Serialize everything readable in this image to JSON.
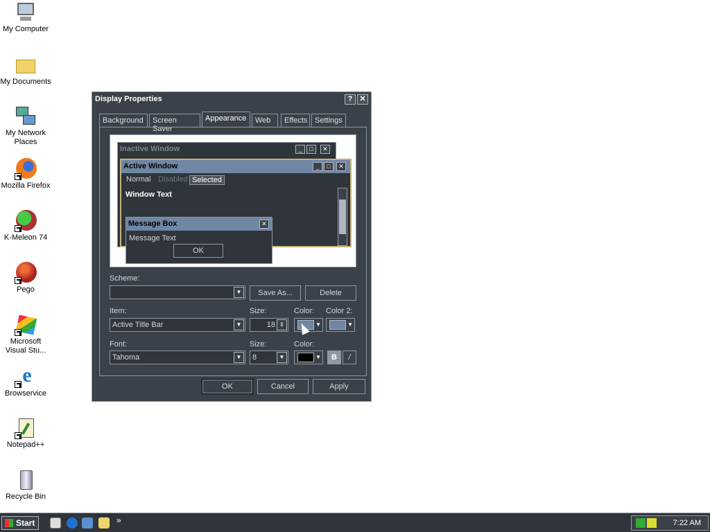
{
  "desktop": {
    "icons": [
      {
        "label": "My Computer"
      },
      {
        "label": "My Documents"
      },
      {
        "label": "My Network Places"
      },
      {
        "label": "Mozilla Firefox"
      },
      {
        "label": "K-Meleon 74"
      },
      {
        "label": "Pego"
      },
      {
        "label": "Microsoft Visual Stu..."
      },
      {
        "label": "Browservice"
      },
      {
        "label": "Notepad++"
      },
      {
        "label": "Recycle Bin"
      }
    ]
  },
  "dialog": {
    "title": "Display Properties",
    "help": "?",
    "close": "✕",
    "tabs": [
      "Background",
      "Screen Saver",
      "Appearance",
      "Web",
      "Effects",
      "Settings"
    ],
    "active_tab": "Appearance",
    "preview": {
      "inactive_title": "Inactive Window",
      "active_title": "Active Window",
      "menu": [
        "Normal",
        "Disabled",
        "Selected"
      ],
      "window_text": "Window Text",
      "msgbox_title": "Message Box",
      "msgbox_text": "Message Text",
      "msgbox_ok": "OK"
    },
    "scheme_label": "Scheme:",
    "scheme_value": "",
    "save_as": "Save As...",
    "delete": "Delete",
    "item_label": "Item:",
    "item_value": "Active Title Bar",
    "size_label": "Size:",
    "item_size": "18",
    "color_label": "Color:",
    "color2_label": "Color 2:",
    "color1": "#6f86a4",
    "color2": "#6f86a4",
    "font_label": "Font:",
    "font_value": "Tahoma",
    "font_size_label": "Size:",
    "font_size": "8",
    "font_color_label": "Color:",
    "font_color": "#000000",
    "bold": "B",
    "italic": "/",
    "ok": "OK",
    "cancel": "Cancel",
    "apply": "Apply"
  },
  "taskbar": {
    "start": "Start",
    "chevron": "»",
    "clock": "7:22 AM"
  }
}
